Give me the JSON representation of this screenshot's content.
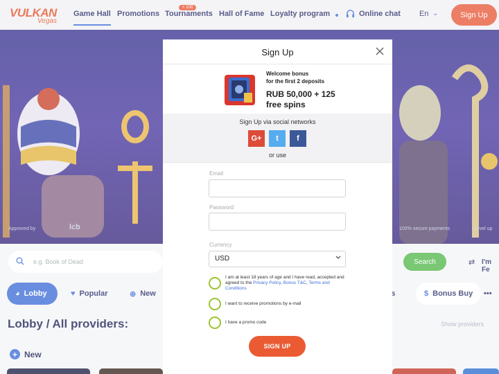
{
  "header": {
    "logo_main": "VULKAN",
    "logo_sub": "Vegas",
    "nav": [
      "Game Hall",
      "Promotions",
      "Tournaments",
      "Hall of Fame",
      "Loyalty program"
    ],
    "tournaments_badge": "+ 100",
    "chat_label": "Online chat",
    "language": "En",
    "signup_label": "Sign Up"
  },
  "hero": {
    "approved_by": "Approved by",
    "lcb": "lcb",
    "secure": "100% secure payments",
    "level_up": "Level up"
  },
  "lobby": {
    "search_placeholder": "e.g. Book of Dead",
    "search_button": "Search",
    "filter_label": "I'm Fe",
    "tabs": [
      "Lobby",
      "Popular",
      "New",
      "ays",
      "Bonus Buy",
      "•••"
    ],
    "title": "Lobby / All providers:",
    "show_providers": "Show providers",
    "new_section": "New"
  },
  "modal": {
    "title": "Sign Up",
    "bonus_line1": "Welcome bonus",
    "bonus_line2": "for the first 2 deposits",
    "bonus_line3": "RUB 50,000 + 125",
    "bonus_line4": "free spins",
    "social_title": "Sign Up via social networks",
    "social": [
      {
        "name": "G+",
        "color": "#dd4b39"
      },
      {
        "name": "t",
        "color": "#55acee"
      },
      {
        "name": "f",
        "color": "#3b5998"
      }
    ],
    "or_use": "or use",
    "email_label": "Email",
    "email_value": "",
    "password_label": "Password",
    "password_value": "",
    "currency_label": "Currency",
    "currency_value": "USD",
    "terms_pre": "I am at least 18 years of age and I have read, accepted and agreed to the ",
    "terms_privacy": "Privacy Policy",
    "terms_bonus": "Bonus T&C",
    "terms_terms": "Terms and Conditions",
    "promo_email": "I want to receive promotions by e-mail",
    "promo_code": "I have a promo code",
    "submit": "SIGN UP"
  },
  "colors": {
    "accent": "#3f6fd8",
    "brand_orange": "#e85a3c",
    "checkbox_green": "#9bc42f",
    "search_green": "#55b84d"
  }
}
